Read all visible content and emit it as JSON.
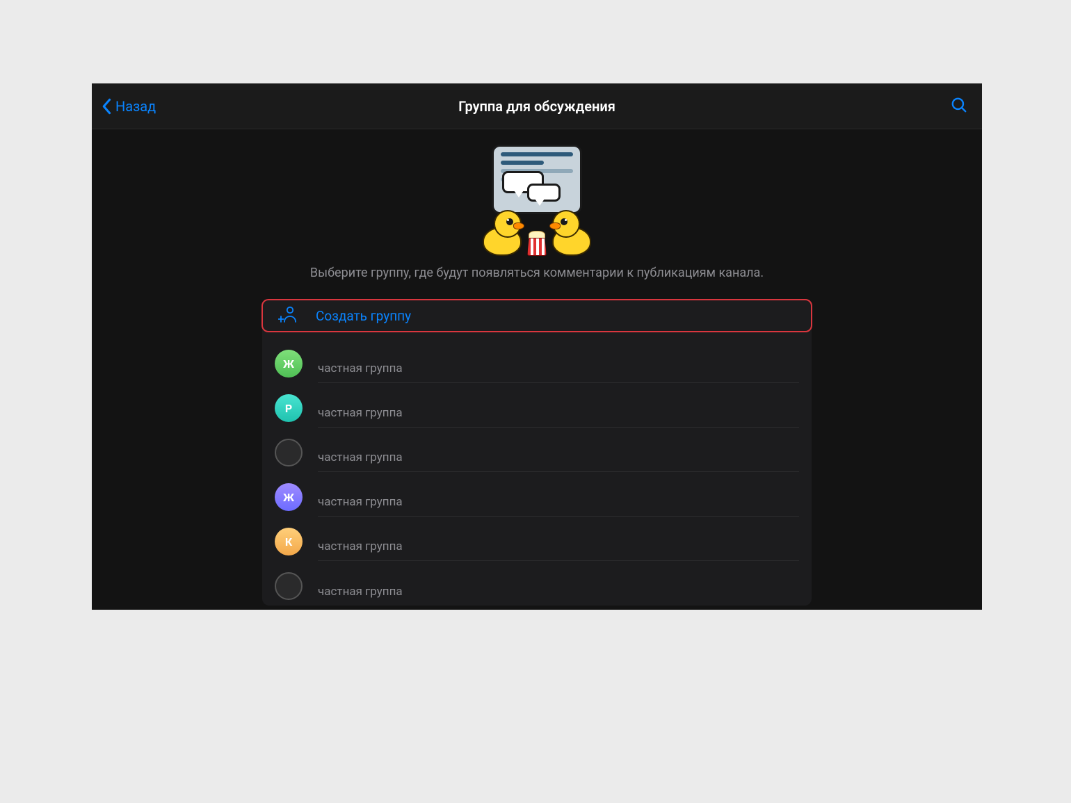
{
  "nav": {
    "back_label": "Назад",
    "title": "Группа для обсуждения"
  },
  "description": "Выберите группу, где будут появляться комментарии к публикациям канала.",
  "create_group_label": "Создать группу",
  "groups": [
    {
      "initial": "Ж",
      "subtitle": "частная группа",
      "avatar_bg": "linear-gradient(180deg,#7fe07a,#4fbf55)",
      "ring": false
    },
    {
      "initial": "P",
      "subtitle": "частная группа",
      "avatar_bg": "linear-gradient(180deg,#49e4d1,#1fc2af)",
      "ring": false
    },
    {
      "initial": "",
      "subtitle": "частная группа",
      "avatar_bg": "#2a2a2b",
      "ring": true
    },
    {
      "initial": "Ж",
      "subtitle": "частная группа",
      "avatar_bg": "linear-gradient(180deg,#9f8bff,#6c6cff)",
      "ring": false
    },
    {
      "initial": "К",
      "subtitle": "частная группа",
      "avatar_bg": "linear-gradient(180deg,#ffcf7a,#f3a84a)",
      "ring": false
    },
    {
      "initial": "",
      "subtitle": "частная группа",
      "avatar_bg": "#2a2a2b",
      "ring": true
    }
  ],
  "colors": {
    "accent": "#0a84ff",
    "highlight_border": "#d9363e"
  }
}
